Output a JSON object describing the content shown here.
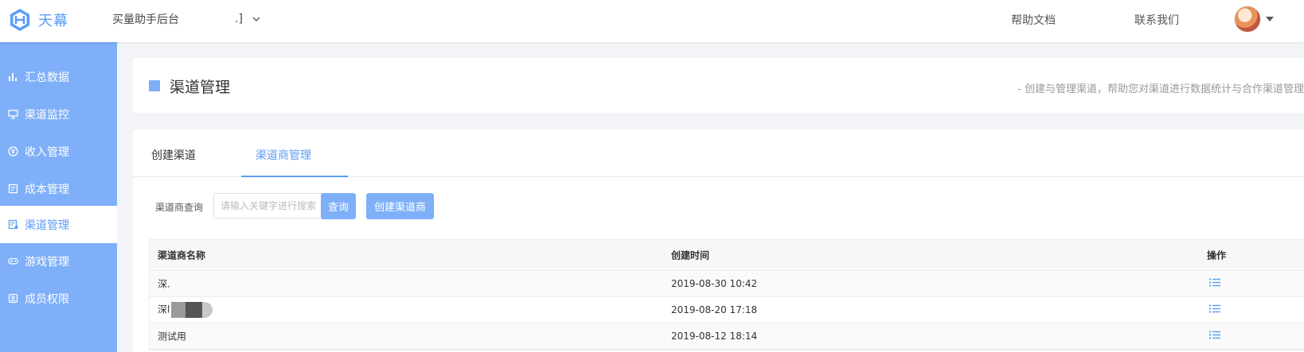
{
  "header": {
    "logo_text": "天幕",
    "app_name": "买量助手后台",
    "app_select_value": ".]",
    "links": [
      "帮助文档",
      "联系我们"
    ]
  },
  "sidebar": {
    "items": [
      {
        "label": "汇总数据",
        "icon": "bar-chart-icon"
      },
      {
        "label": "渠道监控",
        "icon": "monitor-icon"
      },
      {
        "label": "收入管理",
        "icon": "yen-coin-icon"
      },
      {
        "label": "成本管理",
        "icon": "ledger-icon"
      },
      {
        "label": "渠道管理",
        "icon": "channel-doc-icon",
        "active": true
      },
      {
        "label": "游戏管理",
        "icon": "gamepad-icon"
      },
      {
        "label": "成员权限",
        "icon": "member-badge-icon"
      }
    ]
  },
  "page": {
    "title": "渠道管理",
    "description": "- 创建与管理渠道，帮助您对渠道进行数据统计与合作渠道管理"
  },
  "tabs": [
    {
      "label": "创建渠道",
      "active": false
    },
    {
      "label": "渠道商管理",
      "active": true
    }
  ],
  "filter": {
    "label": "渠道商查询",
    "placeholder": "请输入关键字进行搜索",
    "value": "",
    "query_button": "查询",
    "create_button": "创建渠道商"
  },
  "table": {
    "columns": [
      "渠道商名称",
      "创建时间",
      "操作"
    ],
    "rows": [
      {
        "name": "深.",
        "created": "2019-08-30 10:42",
        "redacted": false
      },
      {
        "name": "深l",
        "created": "2019-08-20 17:18",
        "redacted": true
      },
      {
        "name": "测试用",
        "created": "2019-08-12 18:14",
        "redacted": false
      }
    ]
  },
  "colors": {
    "accent": "#5b9cf5",
    "sidebar_bg": "#7eaff8",
    "button_bg": "#7eaff8"
  }
}
